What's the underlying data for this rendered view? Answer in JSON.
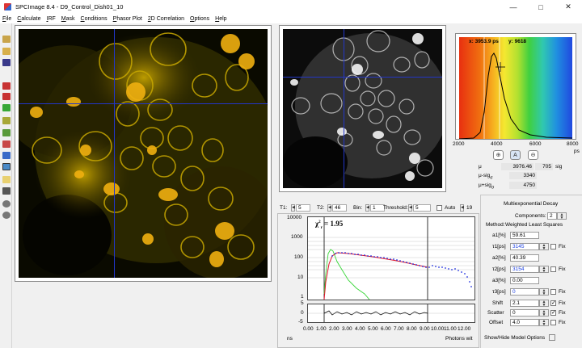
{
  "window": {
    "title": "SPCImage 8.4 - D9_Control_Dish01_10"
  },
  "menu": [
    "File",
    "Calculate",
    "IRF",
    "Mask",
    "Conditions",
    "Phasor Plot",
    "2D Correlation",
    "Options",
    "Help"
  ],
  "histogram": {
    "cursor_x_label": "x: 3953.9  ps",
    "cursor_y_label": "y: 9618",
    "x_ticks": [
      "2000",
      "4000",
      "6000",
      "8000"
    ],
    "x_unit": "ps"
  },
  "stats": {
    "mu_label": "μ",
    "mu_value": "3976.46",
    "sig_value": "705",
    "sig_label": "sig",
    "mu_minus_label": "μ-sig",
    "mu_minus_sub": "σ",
    "mu_minus_value": "3340",
    "mu_plus_label": "μ+sig",
    "mu_plus_sub": "σ",
    "mu_plus_value": "4750"
  },
  "controls": {
    "t1_label": "T1:",
    "t1_value": "5",
    "t2_label": "T2:",
    "t2_value": "46",
    "bin_label": "Bin:",
    "bin_value": "1",
    "threshold_label": "Threshold:",
    "threshold_value": "5",
    "auto_label": "Auto",
    "extra_value": "19"
  },
  "decay_plot": {
    "chi_label": "χ",
    "chi_sub": "r",
    "chi_sup": "2",
    "chi_value": "= 1.95",
    "y_ticks": [
      "10000",
      "1000",
      "100",
      "10",
      "1"
    ],
    "resid_ticks": [
      "5",
      "0",
      "-5"
    ],
    "x_ticks": [
      "0.00",
      "1.00",
      "2.00",
      "3.00",
      "4.00",
      "5.00",
      "6.00",
      "7.00",
      "8.00",
      "9.00",
      "10.00",
      "11.00",
      "12.00"
    ],
    "x_unit": "ns",
    "photons_label": "Photons wit"
  },
  "model": {
    "header": "Multiexponential Decay",
    "components_label": "Components:",
    "components_value": "2",
    "method_label": "Method:",
    "method_value": "Weighted Least Squares",
    "params": [
      {
        "label": "a1[%]",
        "value": "59.61",
        "blue": false,
        "fix": null
      },
      {
        "label": "τ1[ps]",
        "value": "3145",
        "blue": true,
        "fix": "Fix"
      },
      {
        "label": "a2[%]",
        "value": "40.39",
        "blue": false,
        "fix": null
      },
      {
        "label": "τ2[ps]",
        "value": "3154",
        "blue": true,
        "fix": "Fix"
      },
      {
        "label": "a3[%]",
        "value": "0.00",
        "blue": false,
        "fix": null
      },
      {
        "label": "τ3[ps]",
        "value": "0",
        "blue": true,
        "fix": "Fix"
      },
      {
        "label": "Shift",
        "value": "2.1",
        "blue": false,
        "fix": "Fix"
      },
      {
        "label": "Scatter",
        "value": "0",
        "blue": false,
        "fix": "Fix"
      },
      {
        "label": "Offset",
        "value": "4.0",
        "blue": false,
        "fix": "Fix"
      }
    ],
    "show_hide_label": "Show/Hide Model Options"
  },
  "colors": {
    "crosshair": "#2236c8",
    "fit_curve": "#e0142c",
    "irf_curve": "#38d638",
    "data_points": "#2030e0"
  }
}
